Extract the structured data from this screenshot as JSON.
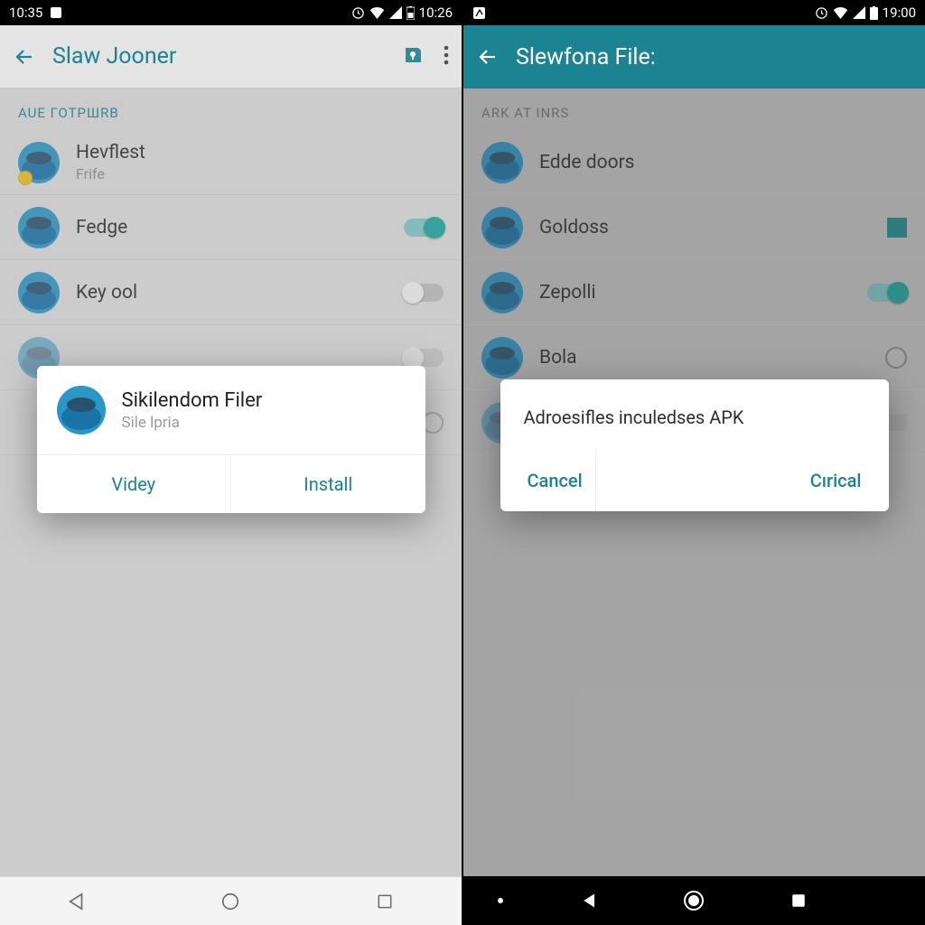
{
  "left": {
    "status": {
      "time_left": "10:35",
      "time_right": "10:26"
    },
    "appbar": {
      "title": "Slaw Jooner"
    },
    "section": "AUE ГОТРШRB",
    "rows": [
      {
        "label": "Hevflest",
        "sublabel": "Frife",
        "control": "badge"
      },
      {
        "label": "Fedge",
        "control": "toggle-on"
      },
      {
        "label": "Key ool",
        "control": "toggle-off"
      },
      {
        "label": "",
        "control": "toggle-off-partial"
      },
      {
        "label": "",
        "control": "radio"
      }
    ],
    "dialog": {
      "title": "Sikilendom Filer",
      "subtitle": "Sile lpria",
      "left_btn": "Videy",
      "right_btn": "Install"
    }
  },
  "right": {
    "status": {
      "time_right": "19:00"
    },
    "appbar": {
      "title": "Slewfona File:"
    },
    "section": "ARK AT INRS",
    "rows": [
      {
        "label": "Edde doors",
        "control": "none"
      },
      {
        "label": "Goldoss",
        "control": "checkbox"
      },
      {
        "label": "Zepolli",
        "control": "toggle-on"
      },
      {
        "label": "Bola",
        "control": "radio"
      },
      {
        "label": "",
        "control": "partial"
      }
    ],
    "dialog": {
      "body": "Adroesifles inculedses APK",
      "left_btn": "Cancel",
      "right_btn": "Cırical"
    }
  },
  "colors": {
    "accent": "#1b8392"
  }
}
